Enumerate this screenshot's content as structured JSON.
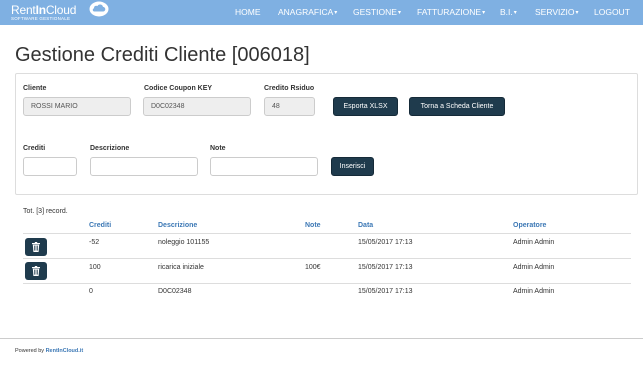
{
  "brand": {
    "name_part1": "Rent",
    "name_part2": "In",
    "name_part3": "Cloud",
    "subtitle": "SOFTWARE GESTIONALE"
  },
  "nav": {
    "items": [
      {
        "label": "HOME",
        "dropdown": false
      },
      {
        "label": "ANAGRAFICA",
        "dropdown": true
      },
      {
        "label": "GESTIONE",
        "dropdown": true
      },
      {
        "label": "FATTURAZIONE",
        "dropdown": true
      },
      {
        "label": "B.I.",
        "dropdown": true
      },
      {
        "label": "SERVIZIO",
        "dropdown": true
      },
      {
        "label": "LOGOUT",
        "dropdown": false
      }
    ],
    "caret": "▾"
  },
  "page_title": "Gestione Crediti Cliente [006018]",
  "info": {
    "cliente_label": "Cliente",
    "cliente_value": "ROSSI MARIO",
    "coupon_label": "Codice Coupon KEY",
    "coupon_value": "D0C02348",
    "credito_label": "Credito Rsiduo",
    "credito_value": "48",
    "export_button": "Esporta XLSX",
    "back_button": "Torna a Scheda Cliente"
  },
  "form": {
    "crediti_label": "Crediti",
    "crediti_value": "",
    "descrizione_label": "Descrizione",
    "descrizione_value": "",
    "note_label": "Note",
    "note_value": "",
    "submit_button": "Inserisci"
  },
  "table": {
    "total_text": "Tot. [3] record.",
    "columns": [
      "Crediti",
      "Descrizione",
      "Note",
      "Data",
      "Operatore"
    ],
    "rows": [
      {
        "deletable": true,
        "crediti": "-52",
        "descrizione": "noleggio 101155",
        "note": "",
        "data": "15/05/2017 17:13",
        "operatore": "Admin Admin"
      },
      {
        "deletable": true,
        "crediti": "100",
        "descrizione": "ricarica iniziale",
        "note": "100€",
        "data": "15/05/2017 17:13",
        "operatore": "Admin Admin"
      },
      {
        "deletable": false,
        "crediti": "0",
        "descrizione": "D0C02348",
        "note": "",
        "data": "15/05/2017 17:13",
        "operatore": "Admin Admin"
      }
    ]
  },
  "footer": {
    "prefix": "Powered by",
    "link": "RentInCloud.it"
  },
  "colors": {
    "navbar": "#7fb0e2",
    "button_dark": "#1f3b4d",
    "link_blue": "#3c78b5"
  },
  "icons": {
    "logo": "cloud-icon",
    "delete": "trash-icon"
  }
}
